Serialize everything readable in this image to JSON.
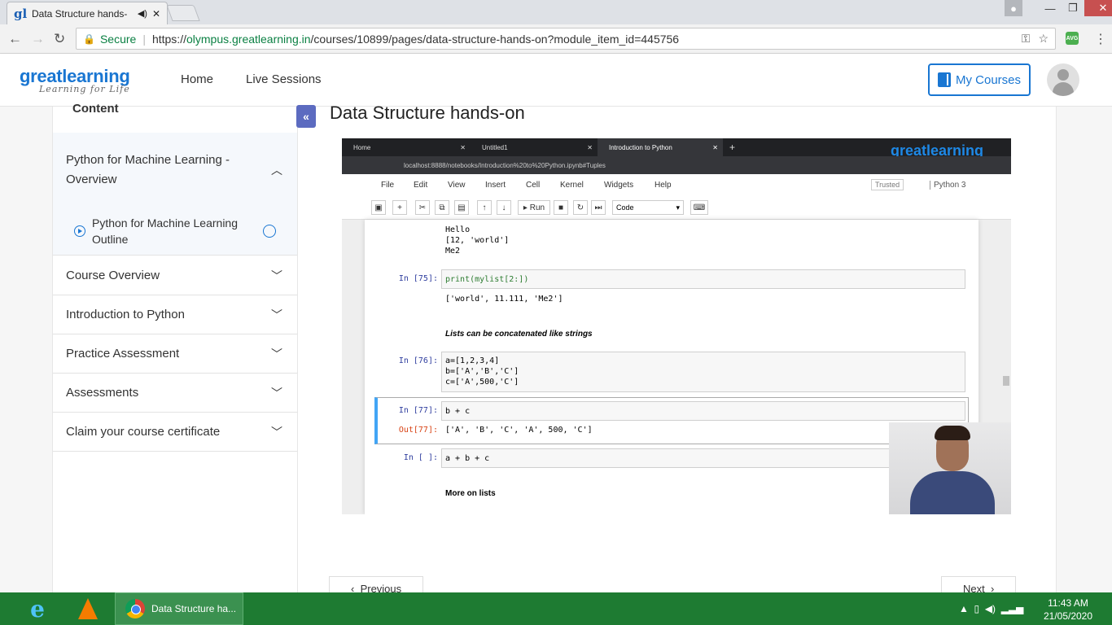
{
  "browser": {
    "tab_title": "Data Structure hands-",
    "url_secure_label": "Secure",
    "url_prefix": "https://",
    "url_host": "olympus.greatlearning.in",
    "url_path": "/courses/10899/pages/data-structure-hands-on?module_item_id=445756"
  },
  "header": {
    "logo_word": "greatlearning",
    "logo_tag": "Learning for Life",
    "nav": [
      "Home",
      "Live Sessions"
    ],
    "my_courses": "My Courses"
  },
  "sidebar": {
    "heading": "Content",
    "sections": [
      {
        "label": "Python for Machine Learning - Overview",
        "open": true
      },
      {
        "label": "Course Overview",
        "open": false
      },
      {
        "label": "Introduction to Python",
        "open": false
      },
      {
        "label": "Practice Assessment",
        "open": false
      },
      {
        "label": "Assessments",
        "open": false
      },
      {
        "label": "Claim your course certificate",
        "open": false
      }
    ],
    "subitem": "Python for Machine Learning Outline"
  },
  "main": {
    "title": "Data Structure hands-on",
    "prev_label": "Previous",
    "next_label": "Next"
  },
  "video": {
    "tabs": [
      "Home",
      "Untitled1",
      "Introduction to Python"
    ],
    "brand": "greatlearning",
    "address": "localhost:8888/notebooks/Introduction%20to%20Python.ipynb#Tuples",
    "menu": [
      "File",
      "Edit",
      "View",
      "Insert",
      "Cell",
      "Kernel",
      "Widgets",
      "Help"
    ],
    "trusted": "Trusted",
    "kernel": "Python 3",
    "run_label": "Run",
    "cell_type": "Code",
    "out_lines": [
      "Hello",
      "[12, 'world']",
      "Me2"
    ],
    "in75_prompt": "In [75]:",
    "in75_code": "print(mylist[2:])",
    "out75": "['world', 11.111, 'Me2']",
    "md1": "Lists can be concatenated like strings",
    "in76_prompt": "In [76]:",
    "in76_code": [
      "a=[1,2,3,4]",
      "b=['A','B','C']",
      "c=['A',500,'C']"
    ],
    "in77_prompt": "In [77]:",
    "in77_code": "b + c",
    "out77_prompt": "Out[77]:",
    "out77": "['A', 'B', 'C', 'A', 500, 'C']",
    "in_empty_prompt": "In [ ]:",
    "in_empty_code": "a + b + c",
    "md2": "More on lists"
  },
  "taskbar": {
    "active_app": "Data Structure ha...",
    "time": "11:43 AM",
    "date": "21/05/2020"
  },
  "colors": {
    "brand_blue": "#1976d2",
    "taskbar_green": "#1e7b32",
    "collapse_purple": "#5c6bc0"
  }
}
